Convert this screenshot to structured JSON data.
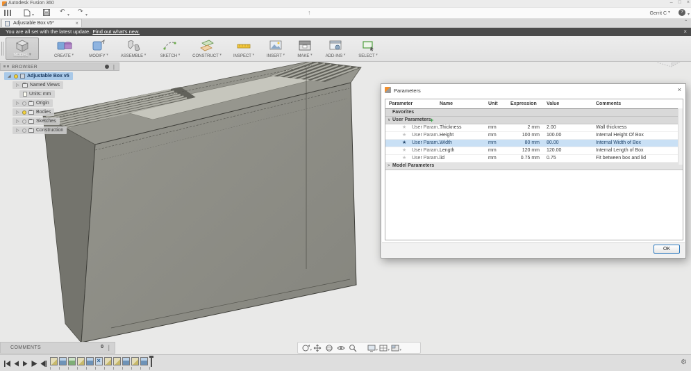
{
  "titlebar": {
    "app_title": "Autodesk Fusion 360"
  },
  "appbar": {
    "user_label": "Gerrit C",
    "help_label": "?",
    "icons": [
      "data-panel",
      "file",
      "save",
      "undo",
      "redo",
      "upload-status"
    ]
  },
  "tab": {
    "label": "Adjustable Box v5*"
  },
  "notification": {
    "message": "You are all set with the latest update.",
    "link_label": "Find out what's new."
  },
  "ribbon": {
    "tabs": [
      {
        "label": "MODEL"
      },
      {
        "label": "CREATE"
      },
      {
        "label": "MODIFY"
      },
      {
        "label": "ASSEMBLE"
      },
      {
        "label": "SKETCH"
      },
      {
        "label": "CONSTRUCT"
      },
      {
        "label": "INSPECT"
      },
      {
        "label": "INSERT"
      },
      {
        "label": "MAKE"
      },
      {
        "label": "ADD-INS"
      },
      {
        "label": "SELECT"
      }
    ]
  },
  "browser": {
    "header": "BROWSER",
    "root_label": "Adjustable Box v5",
    "items": [
      {
        "label": "Named Views"
      },
      {
        "label": "Units: mm"
      },
      {
        "label": "Origin"
      },
      {
        "label": "Bodies"
      },
      {
        "label": "Sketches"
      },
      {
        "label": "Construction"
      }
    ]
  },
  "parameters_dialog": {
    "title": "Parameters",
    "columns": [
      "Parameter",
      "Name",
      "Unit",
      "Expression",
      "Value",
      "Comments"
    ],
    "favorites_label": "Favorites",
    "user_group_label": "User Parameters",
    "model_group_label": "Model Parameters",
    "rows": [
      {
        "parameter": "User Param...",
        "name": "Thickness",
        "unit": "mm",
        "expression": "2 mm",
        "value": "2.00",
        "comments": "Wall thickness",
        "selected": false
      },
      {
        "parameter": "User Param...",
        "name": "Height",
        "unit": "mm",
        "expression": "100 mm",
        "value": "100.00",
        "comments": "Internal Height Of Box",
        "selected": false
      },
      {
        "parameter": "User Param...",
        "name": "Width",
        "unit": "mm",
        "expression": "80 mm",
        "value": "80.00",
        "comments": "Internal Width of Box",
        "selected": true
      },
      {
        "parameter": "User Param...",
        "name": "Length",
        "unit": "mm",
        "expression": "120 mm",
        "value": "120.00",
        "comments": "Internal Length of Box",
        "selected": false
      },
      {
        "parameter": "User Param...",
        "name": "lid",
        "unit": "mm",
        "expression": "0.75 mm",
        "value": "0.75",
        "comments": "Fit between box and lid",
        "selected": false
      }
    ],
    "ok_label": "OK"
  },
  "viewbar": {
    "icons": [
      "orbit",
      "pan",
      "constrained-orbit",
      "zoom-window",
      "zoom",
      "display-settings",
      "grid-display",
      "viewports"
    ]
  },
  "comments_bar": {
    "label": "COMMENTS",
    "count": "0"
  },
  "timeline": {
    "features": [
      "sketch",
      "extrude",
      "revolve",
      "sketch",
      "extrude",
      "mirror",
      "sketch",
      "sketch",
      "extrude",
      "sketch",
      "extrude"
    ]
  },
  "colors": {
    "accent_blue": "#0696d7",
    "selected_row": "#c9e0f5",
    "notification_bg": "#4b4b4b",
    "canvas_bg": "#e9e9e8"
  }
}
